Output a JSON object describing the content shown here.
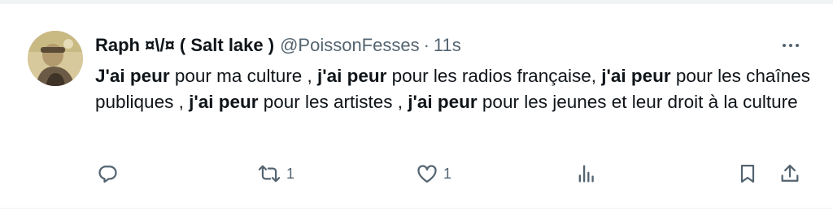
{
  "tweet": {
    "display_name": "Raph ¤\\/¤ ( Salt lake )",
    "handle": "@PoissonFesses",
    "separator": "·",
    "time": "11s",
    "body": [
      {
        "text": "J'ai peur",
        "bold": true
      },
      {
        "text": " pour ma culture , ",
        "bold": false
      },
      {
        "text": "j'ai peur",
        "bold": true
      },
      {
        "text": " pour les radios française, ",
        "bold": false
      },
      {
        "text": "j'ai peur",
        "bold": true
      },
      {
        "text": " pour les chaînes publiques , ",
        "bold": false
      },
      {
        "text": "j'ai peur",
        "bold": true
      },
      {
        "text": " pour les artistes , ",
        "bold": false
      },
      {
        "text": "j'ai peur",
        "bold": true
      },
      {
        "text": " pour les jeunes et leur droit à la culture",
        "bold": false
      }
    ]
  },
  "actions": {
    "reply_count": "",
    "retweet_count": "1",
    "like_count": "1",
    "views_count": ""
  },
  "icons": {
    "reply": "reply-icon",
    "retweet": "retweet-icon",
    "like": "heart-icon",
    "views": "views-icon",
    "bookmark": "bookmark-icon",
    "share": "share-icon",
    "more": "more-icon"
  },
  "colors": {
    "text": "#0f1419",
    "secondary": "#536471",
    "divider": "#eff3f4"
  }
}
